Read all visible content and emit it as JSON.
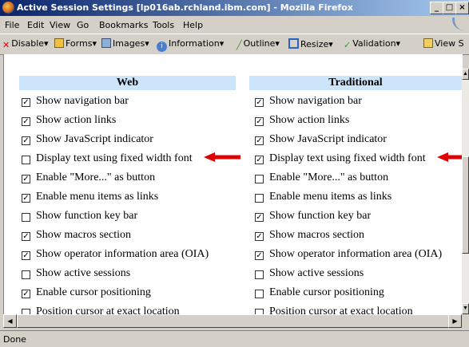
{
  "window": {
    "title": "Active Session Settings [lp016ab.rchland.ibm.com] - Mozilla Firefox"
  },
  "menu": [
    "File",
    "Edit",
    "View",
    "Go",
    "Bookmarks",
    "Tools",
    "Help"
  ],
  "toolbar": {
    "disable": "Disable",
    "forms": "Forms",
    "images": "Images",
    "information": "Information",
    "outline": "Outline",
    "resize": "Resize",
    "validation": "Validation",
    "view_source": "View S"
  },
  "columns": {
    "web": {
      "header": "Web",
      "items": [
        {
          "label": "Show navigation bar",
          "checked": true
        },
        {
          "label": "Show action links",
          "checked": true
        },
        {
          "label": "Show JavaScript indicator",
          "checked": true
        },
        {
          "label": "Display text using fixed width font",
          "checked": false
        },
        {
          "label": "Enable \"More...\" as button",
          "checked": true
        },
        {
          "label": "Enable menu items as links",
          "checked": true
        },
        {
          "label": "Show function key bar",
          "checked": false
        },
        {
          "label": "Show macros section",
          "checked": true
        },
        {
          "label": "Show operator information area (OIA)",
          "checked": true
        },
        {
          "label": "Show active sessions",
          "checked": false
        },
        {
          "label": "Enable cursor positioning",
          "checked": true
        },
        {
          "label": "Position cursor at exact location",
          "checked": false
        }
      ]
    },
    "traditional": {
      "header": "Traditional",
      "items": [
        {
          "label": "Show navigation bar",
          "checked": true
        },
        {
          "label": "Show action links",
          "checked": true
        },
        {
          "label": "Show JavaScript indicator",
          "checked": true
        },
        {
          "label": "Display text using fixed width font",
          "checked": true
        },
        {
          "label": "Enable \"More...\" as button",
          "checked": false
        },
        {
          "label": "Enable menu items as links",
          "checked": false
        },
        {
          "label": "Show function key bar",
          "checked": true
        },
        {
          "label": "Show macros section",
          "checked": true
        },
        {
          "label": "Show operator information area (OIA)",
          "checked": true
        },
        {
          "label": "Show active sessions",
          "checked": false
        },
        {
          "label": "Enable cursor positioning",
          "checked": false
        },
        {
          "label": "Position cursor at exact location",
          "checked": false
        }
      ]
    }
  },
  "status": {
    "text": "Done"
  },
  "colors": {
    "header_bg": "#cde5fb",
    "arrow": "#e00000",
    "titlebar": "#0a246a"
  }
}
